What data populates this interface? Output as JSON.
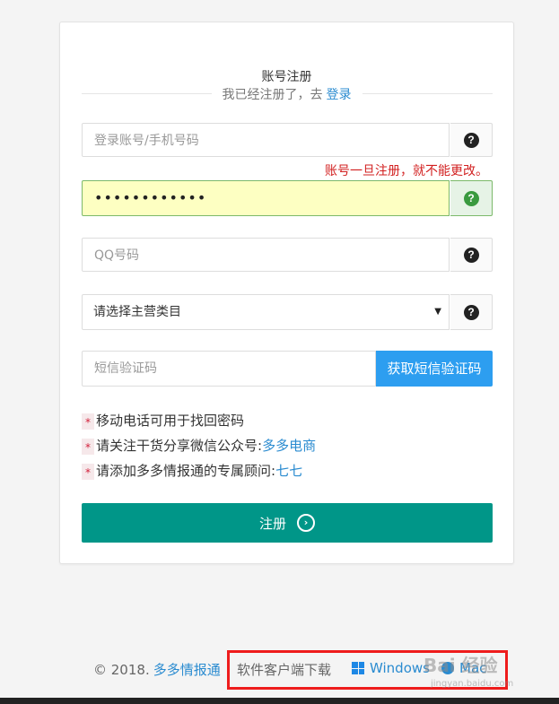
{
  "form": {
    "title": "账号注册",
    "already_text": "我已经注册了，去",
    "login_link": "登录",
    "account": {
      "placeholder": "登录账号/手机号码"
    },
    "account_hint": "账号一旦注册，就不能更改。",
    "password": {
      "value": "••••••••••••"
    },
    "qq": {
      "placeholder": "QQ号码"
    },
    "category": {
      "selected": "请选择主营类目"
    },
    "sms": {
      "placeholder": "短信验证码",
      "button": "获取短信验证码"
    },
    "notes": [
      {
        "star": "*",
        "text": "移动电话可用于找回密码",
        "link": ""
      },
      {
        "star": "*",
        "text": "请关注干货分享微信公众号:",
        "link": "多多电商"
      },
      {
        "star": "*",
        "text": "请添加多多情报通的专属顾问:",
        "link": "七七"
      }
    ],
    "submit_label": "注册"
  },
  "footer": {
    "copyright": "© 2018.",
    "brand": "多多情报通",
    "download_label": "软件客户端下载",
    "windows": "Windows",
    "mac": "Mac"
  },
  "watermark": {
    "main": "Bai 经验",
    "sub": "jingyan.baidu.com"
  },
  "colors": {
    "primary": "#009688",
    "link": "#2a8bd0",
    "sms_button": "#2d9ef0",
    "error": "#d21f1f",
    "highlight_box": "#ee1c1c"
  }
}
